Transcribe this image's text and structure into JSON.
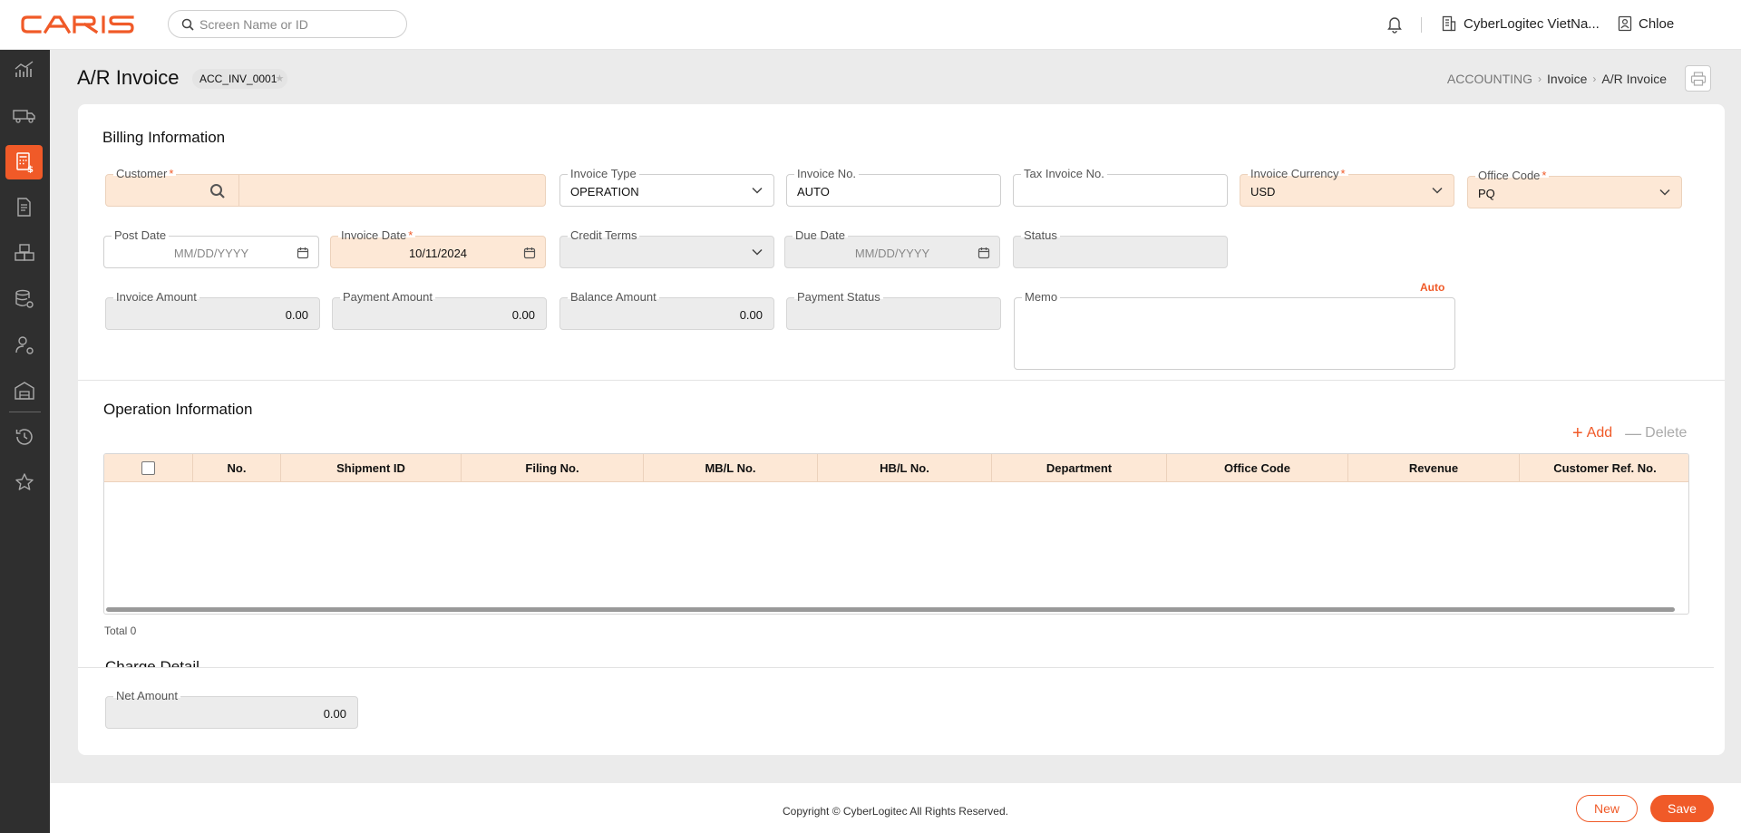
{
  "app": {
    "logo_text": "CARIS"
  },
  "search": {
    "placeholder": "Screen Name or ID"
  },
  "header": {
    "company": "CyberLogitec VietNa...",
    "user": "Chloe"
  },
  "sidebar": {
    "items": [
      {
        "icon": "chart-icon"
      },
      {
        "icon": "truck-icon"
      },
      {
        "icon": "accounting-calculator-icon",
        "active": true
      },
      {
        "icon": "document-icon"
      },
      {
        "icon": "boxes-icon"
      },
      {
        "icon": "database-settings-icon"
      },
      {
        "icon": "user-settings-icon"
      },
      {
        "icon": "warehouse-icon"
      },
      {
        "icon": "history-icon"
      },
      {
        "icon": "star-icon"
      }
    ]
  },
  "page": {
    "title": "A/R Invoice",
    "screen_id": "ACC_INV_0001",
    "breadcrumb": [
      "ACCOUNTING",
      "Invoice",
      "A/R Invoice"
    ]
  },
  "billing": {
    "title": "Billing Information",
    "customer": {
      "label": "Customer",
      "required": true,
      "value": ""
    },
    "invoice_type": {
      "label": "Invoice Type",
      "value": "OPERATION"
    },
    "invoice_no": {
      "label": "Invoice No.",
      "value": "AUTO"
    },
    "tax_invoice_no": {
      "label": "Tax Invoice No.",
      "value": ""
    },
    "invoice_currency": {
      "label": "Invoice Currency",
      "required": true,
      "value": "USD"
    },
    "office_code": {
      "label": "Office Code",
      "required": true,
      "value": "PQ"
    },
    "post_date": {
      "label": "Post Date",
      "placeholder": "MM/DD/YYYY"
    },
    "invoice_date": {
      "label": "Invoice Date",
      "required": true,
      "value": "10/11/2024"
    },
    "credit_terms": {
      "label": "Credit Terms",
      "value": ""
    },
    "due_date": {
      "label": "Due Date",
      "placeholder": "MM/DD/YYYY"
    },
    "status": {
      "label": "Status",
      "value": ""
    },
    "invoice_amount": {
      "label": "Invoice Amount",
      "value": "0.00"
    },
    "payment_amount": {
      "label": "Payment Amount",
      "value": "0.00"
    },
    "balance_amount": {
      "label": "Balance Amount",
      "value": "0.00"
    },
    "payment_status": {
      "label": "Payment Status",
      "value": ""
    },
    "memo": {
      "label": "Memo",
      "value": "",
      "auto_tag": "Auto"
    }
  },
  "operation": {
    "title": "Operation Information",
    "add_label": "Add",
    "delete_label": "Delete",
    "columns": [
      "No.",
      "Shipment ID",
      "Filing No.",
      "MB/L No.",
      "HB/L No.",
      "Department",
      "Office Code",
      "Revenue",
      "Customer Ref. No."
    ],
    "rows": [],
    "total": "Total 0"
  },
  "charge": {
    "title": "Charge Detail",
    "net_amount": {
      "label": "Net Amount",
      "value": "0.00"
    }
  },
  "footer": {
    "copyright": "Copyright © CyberLogitec All Rights Reserved.",
    "new_label": "New",
    "save_label": "Save"
  },
  "colors": {
    "accent": "#f05a28",
    "required_bg": "#fde8d6",
    "sidebar_bg": "#2f2f2f"
  }
}
